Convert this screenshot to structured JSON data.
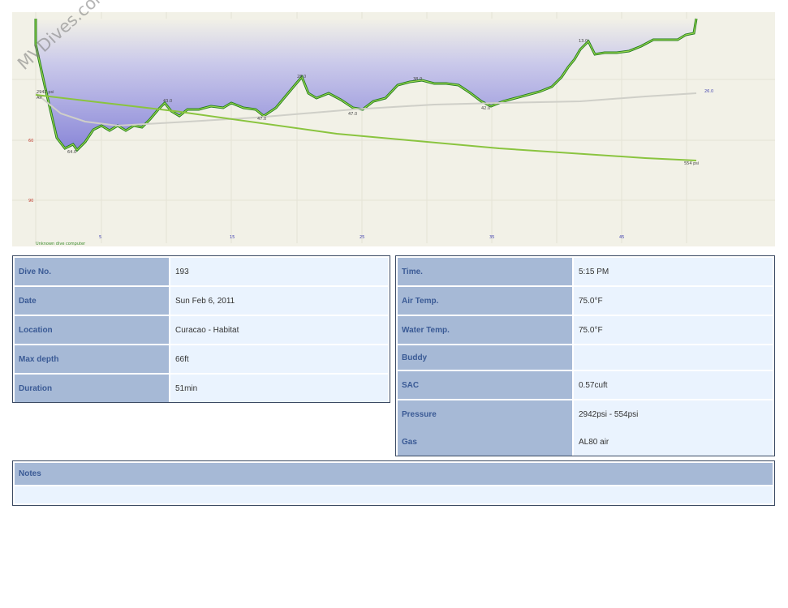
{
  "watermark": "MVDives.com",
  "profile": {
    "depth_axis_labels": [
      "60",
      "90"
    ],
    "time_axis_labels": [
      "5",
      "15",
      "25",
      "35",
      "45"
    ],
    "gas_label": "Air",
    "pressure_start_label": "2942 psi",
    "pressure_end_label": "554 psi",
    "temperature_label": "26.0",
    "computer_label": "Unknown dive computer",
    "depth_annotations": [
      "64.0",
      "47.0",
      "47.0",
      "28.0",
      "43.0",
      "38.0",
      "42.0",
      "13.0"
    ]
  },
  "dive_info": {
    "rows": [
      {
        "label": "Dive No.",
        "value": "193"
      },
      {
        "label": "Date",
        "value": "Sun Feb 6, 2011"
      },
      {
        "label": "Location",
        "value": "Curacao - Habitat"
      },
      {
        "label": "Max depth",
        "value": "66ft"
      },
      {
        "label": "Duration",
        "value": "51min"
      }
    ]
  },
  "dive_details": {
    "rows": [
      {
        "label": "Time.",
        "value": "5:15 PM"
      },
      {
        "label": "Air Temp.",
        "value": "75.0°F"
      },
      {
        "label": "Water Temp.",
        "value": "75.0°F"
      },
      {
        "label": "Buddy",
        "value": ""
      },
      {
        "label": "SAC",
        "value": "0.57cuft"
      },
      {
        "label": "Pressure",
        "value": "2942psi - 554psi"
      },
      {
        "label": "Gas",
        "value": "AL80 air"
      }
    ]
  },
  "notes": {
    "label": "Notes",
    "text": ""
  }
}
